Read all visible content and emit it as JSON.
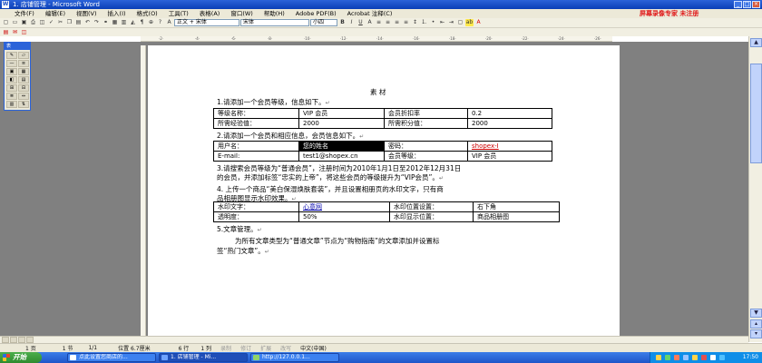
{
  "window": {
    "title": "1. 店铺管理 - Microsoft Word"
  },
  "menu": {
    "items": [
      "文件(F)",
      "编辑(E)",
      "视图(V)",
      "插入(I)",
      "格式(O)",
      "工具(T)",
      "表格(A)",
      "窗口(W)",
      "帮助(H)",
      "Adobe PDF(B)",
      "Acrobat 注释(C)"
    ],
    "overlay_text": "屏幕录像专家 未注册"
  },
  "toolbar": {
    "style": "正文 + 宋体",
    "font": "宋体",
    "size": "小四"
  },
  "drawing_toolbar": {
    "title": "表"
  },
  "document": {
    "title": "素  材",
    "q1": "1.请添加一个会员等级，信息如下。",
    "table1": [
      [
        "等级名称：",
        "VIP 会员",
        "会员折扣率",
        "0.2"
      ],
      [
        "所需经验值：",
        "2000",
        "所需积分值：",
        "2000"
      ]
    ],
    "q2": "2.请添加一个会员和相应信息，会员信息如下。",
    "table2": [
      [
        "用户名：",
        "您的姓名",
        "密码：",
        "shopex-I"
      ],
      [
        "E-mail:",
        "test1@shopex.cn",
        "会员等级：",
        "VIP 会员"
      ]
    ],
    "q3_line1": "3.请搜索会员等级为“普通会员”，注册时间为2010年1月1日至2012年12月31日",
    "q3_line2": "的会员，并添加标签“忠实的上帝”，将这些会员的等级提升为“VIP会员”。",
    "q4_line1": "4. 上传一个商品“美白保湿焕肤套装”，并且设置相册页的水印文字，只有商",
    "q4_line2": "品相册图显示水印效果。",
    "table3": [
      [
        "水印文字：",
        "心意网",
        "水印位置设置：",
        "右下角"
      ],
      [
        "透明度：",
        "50%",
        "水印显示位置：",
        "商品相册图"
      ]
    ],
    "q5": "5.文章管理。",
    "q5_line1": "为所有文章类型为“普通文章”节点为“购物指南”的文章添加并设置标",
    "q5_line2": "签“热门文章”。"
  },
  "statusbar": {
    "page": "1 页",
    "section": "1 节",
    "pages": "1/1",
    "position": "位置 6.7厘米",
    "line": "6 行",
    "column": "1 列",
    "rec": "录制",
    "trk": "修订",
    "ext": "扩展",
    "ovr": "改写",
    "language": "中文(中国)"
  },
  "taskbar": {
    "start": "开始",
    "tasks": [
      "点此设置您商店的...",
      "1. 店铺管理 - Mi...",
      "http://127.0.0.1..."
    ],
    "clock": "17:50"
  }
}
